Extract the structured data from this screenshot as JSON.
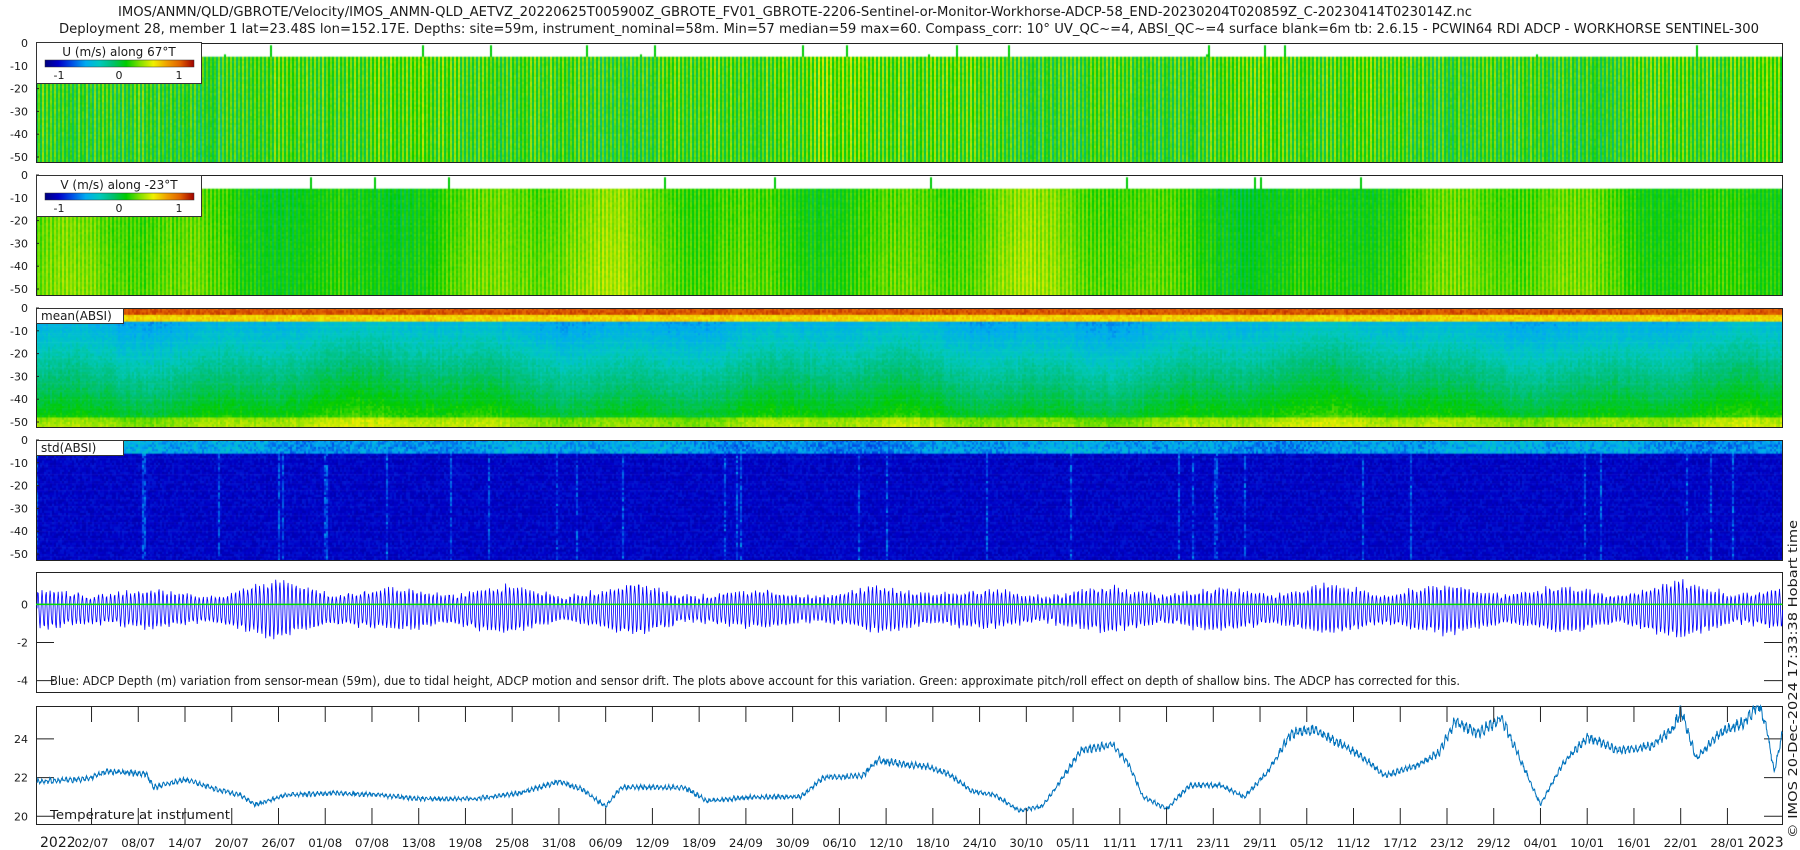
{
  "title": {
    "line1": "IMOS/ANMN/QLD/GBROTE/Velocity/IMOS_ANMN-QLD_AETVZ_20220625T005900Z_GBROTE_FV01_GBROTE-2206-Sentinel-or-Monitor-Workhorse-ADCP-58_END-20230204T020859Z_C-20230414T023014Z.nc",
    "line2": "Deployment 28, member 1 lat=23.48S lon=152.17E. Depths: site=59m, instrument_nominal=58m. Min=57 median=59 max=60. Compass_corr: 10° UV_QC~=4, ABSI_QC~=4 surface blank=6m tb: 2.6.15 - PCWIN64 RDI ADCP - WORKHORSE SENTINEL-300"
  },
  "credit": "© IMOS 20-Dec-2024 17:33:38 Hobart time",
  "colormap": [
    "#00007f",
    "#0000c8",
    "#0050e6",
    "#00aaf0",
    "#00c8c0",
    "#00c070",
    "#00cc00",
    "#80e000",
    "#f0f000",
    "#f0a000",
    "#e06000",
    "#a00000"
  ],
  "chart_data": [
    {
      "type": "heatmap",
      "id": "u",
      "legend": "U (m/s) along 67°T",
      "colorbar_ticks": [
        "-1",
        "0",
        "1"
      ],
      "clim": [
        -1.25,
        1.25
      ],
      "ylim": [
        -52,
        0
      ],
      "yticks": [
        "0",
        "-10",
        "-20",
        "-30",
        "-40",
        "-50"
      ],
      "surface_blank_m": 6,
      "typical_range": [
        -0.1,
        0.7
      ]
    },
    {
      "type": "heatmap",
      "id": "v",
      "legend": "V (m/s) along -23°T",
      "colorbar_ticks": [
        "-1",
        "0",
        "1"
      ],
      "clim": [
        -1.25,
        1.25
      ],
      "ylim": [
        -52,
        0
      ],
      "yticks": [
        "0",
        "-10",
        "-20",
        "-30",
        "-40",
        "-50"
      ],
      "surface_blank_m": 6,
      "typical_range": [
        -0.1,
        0.7
      ]
    },
    {
      "type": "heatmap",
      "id": "mean_absi",
      "legend": "mean(ABSI)",
      "ylim": [
        -52,
        0
      ],
      "yticks": [
        "0",
        "-10",
        "-20",
        "-30",
        "-40",
        "-50"
      ]
    },
    {
      "type": "heatmap",
      "id": "std_absi",
      "legend": "std(ABSI)",
      "ylim": [
        -52,
        0
      ],
      "yticks": [
        "0",
        "-10",
        "-20",
        "-30",
        "-40",
        "-50"
      ]
    },
    {
      "type": "line",
      "id": "depth",
      "annotation": "Blue: ADCP Depth (m) variation from sensor-mean (59m), due to tidal height, ADCP motion and sensor drift. The plots above account for this variation. Green: approximate pitch/roll effect on depth of shallow bins. The ADCP has corrected for this.",
      "ylim": [
        -4.6,
        1.7
      ],
      "yticks": [
        {
          "v": 0,
          "label": "0"
        },
        {
          "v": -2,
          "label": "-2"
        },
        {
          "v": -4,
          "label": "-4"
        }
      ],
      "series": [
        {
          "color": "#0000ff",
          "tidal_amplitude_m": [
            [
              "2022-06-25",
              1.0
            ],
            [
              "2022-07-02",
              0.7
            ],
            [
              "2022-07-10",
              1.0
            ],
            [
              "2022-07-17",
              0.6
            ],
            [
              "2022-07-26",
              1.5
            ],
            [
              "2022-08-02",
              0.7
            ],
            [
              "2022-08-10",
              1.1
            ],
            [
              "2022-08-17",
              0.7
            ],
            [
              "2022-08-24",
              1.2
            ],
            [
              "2022-09-01",
              0.6
            ],
            [
              "2022-09-10",
              1.3
            ],
            [
              "2022-09-17",
              0.6
            ],
            [
              "2022-09-26",
              1.0
            ],
            [
              "2022-10-03",
              0.6
            ],
            [
              "2022-10-11",
              1.2
            ],
            [
              "2022-10-18",
              0.7
            ],
            [
              "2022-10-25",
              1.0
            ],
            [
              "2022-11-01",
              0.6
            ],
            [
              "2022-11-09",
              1.2
            ],
            [
              "2022-11-16",
              0.7
            ],
            [
              "2022-11-24",
              1.1
            ],
            [
              "2022-12-01",
              0.7
            ],
            [
              "2022-12-08",
              1.3
            ],
            [
              "2022-12-15",
              0.7
            ],
            [
              "2022-12-23",
              1.3
            ],
            [
              "2022-12-30",
              0.7
            ],
            [
              "2023-01-07",
              1.2
            ],
            [
              "2023-01-14",
              0.7
            ],
            [
              "2023-01-22",
              1.5
            ],
            [
              "2023-01-29",
              0.7
            ],
            [
              "2023-02-04",
              1.0
            ]
          ]
        },
        {
          "color": "#00dd00",
          "constant": 0
        }
      ]
    },
    {
      "type": "line",
      "id": "temperature",
      "annotation": "Temperature at instrument",
      "ylim": [
        19.6,
        25.7
      ],
      "yticks": [
        {
          "v": 20,
          "label": "20"
        },
        {
          "v": 22,
          "label": "22"
        },
        {
          "v": 24,
          "label": "24"
        }
      ],
      "series": [
        {
          "color": "#0072bd",
          "points": [
            [
              "2022-06-25",
              21.8
            ],
            [
              "2022-07-01",
              21.9
            ],
            [
              "2022-07-04",
              22.3
            ],
            [
              "2022-07-09",
              22.2
            ],
            [
              "2022-07-10",
              21.5
            ],
            [
              "2022-07-14",
              21.9
            ],
            [
              "2022-07-18",
              21.4
            ],
            [
              "2022-07-21",
              21.1
            ],
            [
              "2022-07-23",
              20.6
            ],
            [
              "2022-07-27",
              21.1
            ],
            [
              "2022-08-02",
              21.2
            ],
            [
              "2022-08-08",
              21.1
            ],
            [
              "2022-08-13",
              20.9
            ],
            [
              "2022-08-16",
              20.9
            ],
            [
              "2022-08-20",
              20.9
            ],
            [
              "2022-08-26",
              21.2
            ],
            [
              "2022-08-31",
              21.8
            ],
            [
              "2022-09-03",
              21.4
            ],
            [
              "2022-09-06",
              20.5
            ],
            [
              "2022-09-08",
              21.5
            ],
            [
              "2022-09-16",
              21.5
            ],
            [
              "2022-09-19",
              20.8
            ],
            [
              "2022-09-25",
              21.0
            ],
            [
              "2022-10-01",
              21.0
            ],
            [
              "2022-10-04",
              22.0
            ],
            [
              "2022-10-09",
              22.1
            ],
            [
              "2022-10-11",
              22.9
            ],
            [
              "2022-10-14",
              22.7
            ],
            [
              "2022-10-17",
              22.6
            ],
            [
              "2022-10-20",
              22.2
            ],
            [
              "2022-10-23",
              21.3
            ],
            [
              "2022-10-26",
              21.1
            ],
            [
              "2022-10-29",
              20.3
            ],
            [
              "2022-11-01",
              20.5
            ],
            [
              "2022-11-03",
              21.6
            ],
            [
              "2022-11-06",
              23.4
            ],
            [
              "2022-11-10",
              23.7
            ],
            [
              "2022-11-12",
              22.8
            ],
            [
              "2022-11-14",
              21.0
            ],
            [
              "2022-11-17",
              20.4
            ],
            [
              "2022-11-20",
              21.6
            ],
            [
              "2022-11-24",
              21.6
            ],
            [
              "2022-11-27",
              21.0
            ],
            [
              "2022-11-30",
              22.3
            ],
            [
              "2022-12-03",
              24.3
            ],
            [
              "2022-12-06",
              24.5
            ],
            [
              "2022-12-09",
              23.8
            ],
            [
              "2022-12-12",
              23.1
            ],
            [
              "2022-12-15",
              22.1
            ],
            [
              "2022-12-19",
              22.6
            ],
            [
              "2022-12-22",
              23.3
            ],
            [
              "2022-12-24",
              24.9
            ],
            [
              "2022-12-27",
              24.3
            ],
            [
              "2022-12-30",
              25.1
            ],
            [
              "2023-01-01",
              23.3
            ],
            [
              "2023-01-04",
              20.6
            ],
            [
              "2023-01-07",
              22.8
            ],
            [
              "2023-01-10",
              24.1
            ],
            [
              "2023-01-14",
              23.4
            ],
            [
              "2023-01-18",
              23.6
            ],
            [
              "2023-01-21",
              24.5
            ],
            [
              "2023-01-22",
              25.5
            ],
            [
              "2023-01-24",
              23.0
            ],
            [
              "2023-01-27",
              24.3
            ],
            [
              "2023-01-30",
              24.8
            ],
            [
              "2023-02-01",
              25.8
            ],
            [
              "2023-02-02",
              24.6
            ],
            [
              "2023-02-03",
              22.3
            ],
            [
              "2023-02-04",
              24.2
            ]
          ]
        }
      ]
    }
  ],
  "xaxis": {
    "start": "2022-06-25",
    "end": "2023-02-04",
    "year_start": "2022",
    "year_end": "2023",
    "ticks": [
      "02/07",
      "08/07",
      "14/07",
      "20/07",
      "26/07",
      "01/08",
      "07/08",
      "13/08",
      "19/08",
      "25/08",
      "31/08",
      "06/09",
      "12/09",
      "18/09",
      "24/09",
      "30/09",
      "06/10",
      "12/10",
      "18/10",
      "24/10",
      "30/10",
      "05/11",
      "11/11",
      "17/11",
      "23/11",
      "29/11",
      "05/12",
      "11/12",
      "17/12",
      "23/12",
      "29/12",
      "04/01",
      "10/01",
      "16/01",
      "22/01",
      "28/01"
    ]
  }
}
